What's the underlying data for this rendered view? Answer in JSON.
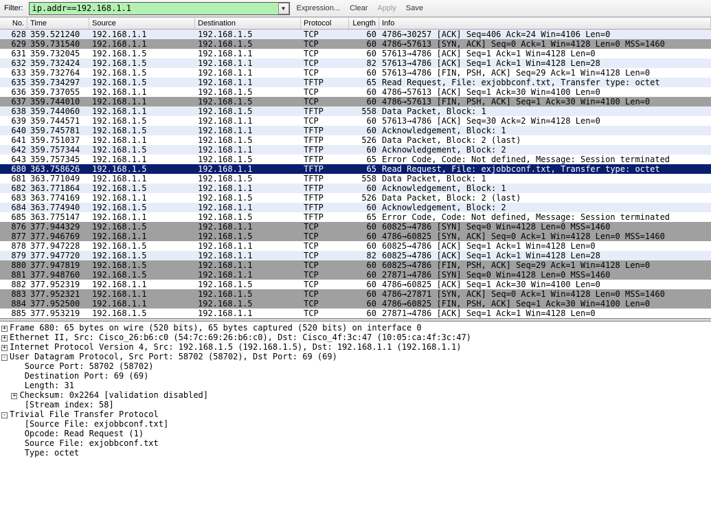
{
  "toolbar": {
    "filter_label": "Filter:",
    "filter_value": "ip.addr==192.168.1.1",
    "expression": "Expression...",
    "clear": "Clear",
    "apply": "Apply",
    "save": "Save"
  },
  "columns": {
    "no": "No.",
    "time": "Time",
    "source": "Source",
    "destination": "Destination",
    "protocol": "Protocol",
    "length": "Length",
    "info": "Info"
  },
  "packets": [
    {
      "no": "628",
      "time": "359.521240",
      "src": "192.168.1.1",
      "dst": "192.168.1.5",
      "proto": "TCP",
      "len": "60",
      "info": "4786→30257 [ACK] Seq=406 Ack=24 Win=4106 Len=0",
      "style": "blue"
    },
    {
      "no": "629",
      "time": "359.731540",
      "src": "192.168.1.1",
      "dst": "192.168.1.5",
      "proto": "TCP",
      "len": "60",
      "info": "4786→57613 [SYN, ACK] Seq=0 Ack=1 Win=4128 Len=0 MSS=1460",
      "style": "gray"
    },
    {
      "no": "631",
      "time": "359.732045",
      "src": "192.168.1.5",
      "dst": "192.168.1.1",
      "proto": "TCP",
      "len": "60",
      "info": "57613→4786 [ACK] Seq=1 Ack=1 Win=4128 Len=0",
      "style": "white"
    },
    {
      "no": "632",
      "time": "359.732424",
      "src": "192.168.1.5",
      "dst": "192.168.1.1",
      "proto": "TCP",
      "len": "82",
      "info": "57613→4786 [ACK] Seq=1 Ack=1 Win=4128 Len=28",
      "style": "blue"
    },
    {
      "no": "633",
      "time": "359.732764",
      "src": "192.168.1.5",
      "dst": "192.168.1.1",
      "proto": "TCP",
      "len": "60",
      "info": "57613→4786 [FIN, PSH, ACK] Seq=29 Ack=1 Win=4128 Len=0",
      "style": "white"
    },
    {
      "no": "635",
      "time": "359.734297",
      "src": "192.168.1.5",
      "dst": "192.168.1.1",
      "proto": "TFTP",
      "len": "65",
      "info": "Read Request, File: exjobbconf.txt, Transfer type: octet",
      "style": "blue"
    },
    {
      "no": "636",
      "time": "359.737055",
      "src": "192.168.1.1",
      "dst": "192.168.1.5",
      "proto": "TCP",
      "len": "60",
      "info": "4786→57613 [ACK] Seq=1 Ack=30 Win=4100 Len=0",
      "style": "white"
    },
    {
      "no": "637",
      "time": "359.744010",
      "src": "192.168.1.1",
      "dst": "192.168.1.5",
      "proto": "TCP",
      "len": "60",
      "info": "4786→57613 [FIN, PSH, ACK] Seq=1 Ack=30 Win=4100 Len=0",
      "style": "gray"
    },
    {
      "no": "638",
      "time": "359.744060",
      "src": "192.168.1.1",
      "dst": "192.168.1.5",
      "proto": "TFTP",
      "len": "558",
      "info": "Data Packet, Block: 1",
      "style": "blue"
    },
    {
      "no": "639",
      "time": "359.744571",
      "src": "192.168.1.5",
      "dst": "192.168.1.1",
      "proto": "TCP",
      "len": "60",
      "info": "57613→4786 [ACK] Seq=30 Ack=2 Win=4128 Len=0",
      "style": "white"
    },
    {
      "no": "640",
      "time": "359.745781",
      "src": "192.168.1.5",
      "dst": "192.168.1.1",
      "proto": "TFTP",
      "len": "60",
      "info": "Acknowledgement, Block: 1",
      "style": "blue"
    },
    {
      "no": "641",
      "time": "359.751037",
      "src": "192.168.1.1",
      "dst": "192.168.1.5",
      "proto": "TFTP",
      "len": "526",
      "info": "Data Packet, Block: 2 (last)",
      "style": "white"
    },
    {
      "no": "642",
      "time": "359.757344",
      "src": "192.168.1.5",
      "dst": "192.168.1.1",
      "proto": "TFTP",
      "len": "60",
      "info": "Acknowledgement, Block: 2",
      "style": "blue"
    },
    {
      "no": "643",
      "time": "359.757345",
      "src": "192.168.1.1",
      "dst": "192.168.1.5",
      "proto": "TFTP",
      "len": "65",
      "info": "Error Code, Code: Not defined, Message: Session terminated",
      "style": "white"
    },
    {
      "no": "680",
      "time": "363.758626",
      "src": "192.168.1.5",
      "dst": "192.168.1.1",
      "proto": "TFTP",
      "len": "65",
      "info": "Read Request, File: exjobbconf.txt, Transfer type: octet",
      "style": "sel"
    },
    {
      "no": "681",
      "time": "363.771049",
      "src": "192.168.1.1",
      "dst": "192.168.1.5",
      "proto": "TFTP",
      "len": "558",
      "info": "Data Packet, Block: 1",
      "style": "white"
    },
    {
      "no": "682",
      "time": "363.771864",
      "src": "192.168.1.5",
      "dst": "192.168.1.1",
      "proto": "TFTP",
      "len": "60",
      "info": "Acknowledgement, Block: 1",
      "style": "blue"
    },
    {
      "no": "683",
      "time": "363.774169",
      "src": "192.168.1.1",
      "dst": "192.168.1.5",
      "proto": "TFTP",
      "len": "526",
      "info": "Data Packet, Block: 2 (last)",
      "style": "white"
    },
    {
      "no": "684",
      "time": "363.774940",
      "src": "192.168.1.5",
      "dst": "192.168.1.1",
      "proto": "TFTP",
      "len": "60",
      "info": "Acknowledgement, Block: 2",
      "style": "blue"
    },
    {
      "no": "685",
      "time": "363.775147",
      "src": "192.168.1.1",
      "dst": "192.168.1.5",
      "proto": "TFTP",
      "len": "65",
      "info": "Error Code, Code: Not defined, Message: Session terminated",
      "style": "white"
    },
    {
      "no": "876",
      "time": "377.944329",
      "src": "192.168.1.5",
      "dst": "192.168.1.1",
      "proto": "TCP",
      "len": "60",
      "info": "60825→4786 [SYN] Seq=0 Win=4128 Len=0 MSS=1460",
      "style": "gray"
    },
    {
      "no": "877",
      "time": "377.946769",
      "src": "192.168.1.1",
      "dst": "192.168.1.5",
      "proto": "TCP",
      "len": "60",
      "info": "4786→60825 [SYN, ACK] Seq=0 Ack=1 Win=4128 Len=0 MSS=1460",
      "style": "gray"
    },
    {
      "no": "878",
      "time": "377.947228",
      "src": "192.168.1.5",
      "dst": "192.168.1.1",
      "proto": "TCP",
      "len": "60",
      "info": "60825→4786 [ACK] Seq=1 Ack=1 Win=4128 Len=0",
      "style": "white"
    },
    {
      "no": "879",
      "time": "377.947720",
      "src": "192.168.1.5",
      "dst": "192.168.1.1",
      "proto": "TCP",
      "len": "82",
      "info": "60825→4786 [ACK] Seq=1 Ack=1 Win=4128 Len=28",
      "style": "blue"
    },
    {
      "no": "880",
      "time": "377.947819",
      "src": "192.168.1.5",
      "dst": "192.168.1.1",
      "proto": "TCP",
      "len": "60",
      "info": "60825→4786 [FIN, PSH, ACK] Seq=29 Ack=1 Win=4128 Len=0",
      "style": "gray"
    },
    {
      "no": "881",
      "time": "377.948760",
      "src": "192.168.1.5",
      "dst": "192.168.1.1",
      "proto": "TCP",
      "len": "60",
      "info": "27871→4786 [SYN] Seq=0 Win=4128 Len=0 MSS=1460",
      "style": "gray"
    },
    {
      "no": "882",
      "time": "377.952319",
      "src": "192.168.1.1",
      "dst": "192.168.1.5",
      "proto": "TCP",
      "len": "60",
      "info": "4786→60825 [ACK] Seq=1 Ack=30 Win=4100 Len=0",
      "style": "white"
    },
    {
      "no": "883",
      "time": "377.952321",
      "src": "192.168.1.1",
      "dst": "192.168.1.5",
      "proto": "TCP",
      "len": "60",
      "info": "4786→27871 [SYN, ACK] Seq=0 Ack=1 Win=4128 Len=0 MSS=1460",
      "style": "gray"
    },
    {
      "no": "884",
      "time": "377.952500",
      "src": "192.168.1.1",
      "dst": "192.168.1.5",
      "proto": "TCP",
      "len": "60",
      "info": "4786→60825 [FIN, PSH, ACK] Seq=1 Ack=30 Win=4100 Len=0",
      "style": "gray"
    },
    {
      "no": "885",
      "time": "377.953219",
      "src": "192.168.1.5",
      "dst": "192.168.1.1",
      "proto": "TCP",
      "len": "60",
      "info": "27871→4786 [ACK] Seq=1 Ack=1 Win=4128 Len=0",
      "style": "white"
    }
  ],
  "details": {
    "l0": "Frame 680: 65 bytes on wire (520 bits), 65 bytes captured (520 bits) on interface 0",
    "l1": "Ethernet II, Src: Cisco_26:b6:c0 (54:7c:69:26:b6:c0), Dst: Cisco_4f:3c:47 (10:05:ca:4f:3c:47)",
    "l2": "Internet Protocol Version 4, Src: 192.168.1.5 (192.168.1.5), Dst: 192.168.1.1 (192.168.1.1)",
    "l3": "User Datagram Protocol, Src Port: 58702 (58702), Dst Port: 69 (69)",
    "l4": "Source Port: 58702 (58702)",
    "l5": "Destination Port: 69 (69)",
    "l6": "Length: 31",
    "l7": "Checksum: 0x2264 [validation disabled]",
    "l8": "[Stream index: 58]",
    "l9": "Trivial File Transfer Protocol",
    "l10": "[Source File: exjobbconf.txt]",
    "l11": "Opcode: Read Request (1)",
    "l12": "Source File: exjobbconf.txt",
    "l13": "Type: octet"
  }
}
